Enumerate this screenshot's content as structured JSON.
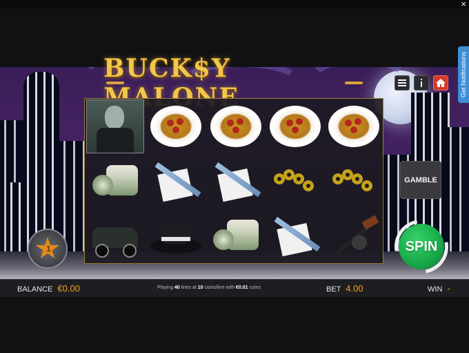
{
  "window": {
    "close_glyph": "×"
  },
  "logo": {
    "title": "BUCK$Y MALONE"
  },
  "header_buttons": {
    "menu_icon": "menu-icon",
    "info_icon": "info-icon",
    "home_icon": "home-icon"
  },
  "notifications_tab": {
    "label": "Get Notifications"
  },
  "reels": {
    "rows": [
      [
        "boss",
        "spaghetti",
        "spaghetti",
        "spaghetti",
        "spaghetti"
      ],
      [
        "cash",
        "razor",
        "razor",
        "knuckles",
        "knuckles"
      ],
      [
        "car",
        "fedora",
        "cash",
        "razor",
        "tommy-gun"
      ]
    ]
  },
  "bonus_star": {
    "count": "1"
  },
  "gamble": {
    "label": "GAMBLE"
  },
  "spin": {
    "label": "SPIN"
  },
  "status": {
    "balance_label": "BALANCE",
    "balance_value": "€0.00",
    "info_prefix": "Playing ",
    "info_lines": "40",
    "info_mid": " lines at ",
    "info_coins": "10",
    "info_mid2": " coins/line with ",
    "info_coin_value": "€0.01",
    "info_suffix": " coins",
    "bet_label": "BET",
    "bet_value": "4.00",
    "win_label": "WIN",
    "win_value": "-"
  },
  "colors": {
    "accent": "#f0a21c",
    "spin_green": "#17a848",
    "home_red": "#d23a2a",
    "notif_blue": "#3d8fd6"
  }
}
